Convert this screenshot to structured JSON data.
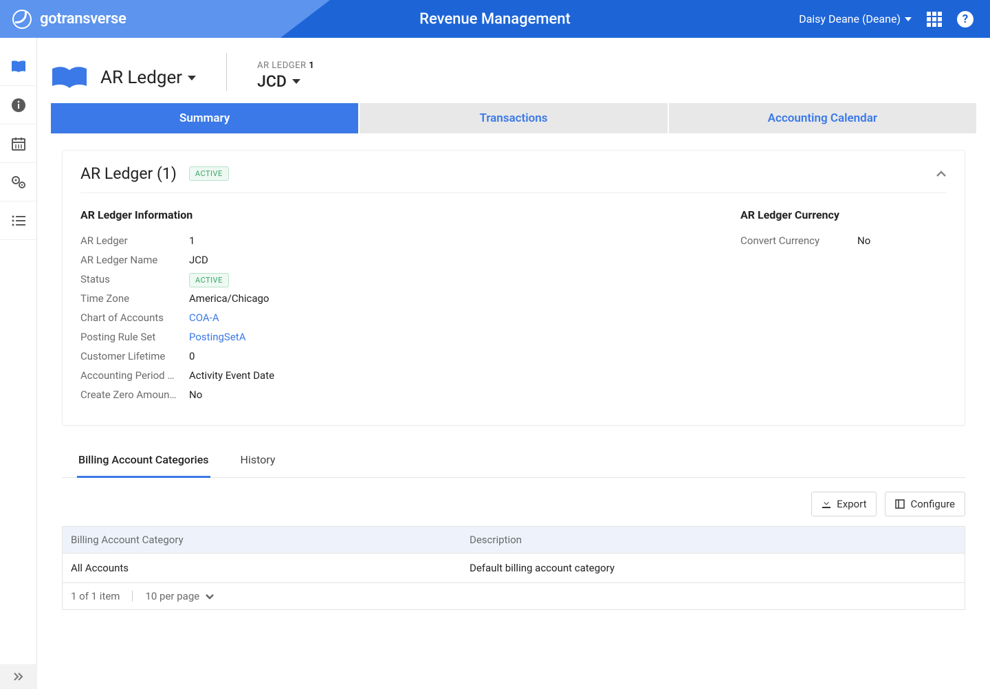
{
  "header": {
    "brand": "gotransverse",
    "title": "Revenue Management",
    "user": "Daisy Deane (Deane)"
  },
  "breadcrumb": {
    "ledger_label": "AR Ledger",
    "sub_label": "AR LEDGER",
    "sub_label_num": "1",
    "sub_value": "JCD"
  },
  "tabs": {
    "summary": "Summary",
    "transactions": "Transactions",
    "calendar": "Accounting Calendar"
  },
  "card": {
    "title": "AR Ledger (1)",
    "badge": "ACTIVE",
    "info_section_title": "AR Ledger Information",
    "currency_section_title": "AR Ledger Currency",
    "rows": {
      "ar_ledger_label": "AR Ledger",
      "ar_ledger_val": "1",
      "name_label": "AR Ledger Name",
      "name_val": "JCD",
      "status_label": "Status",
      "status_val": "ACTIVE",
      "tz_label": "Time Zone",
      "tz_val": "America/Chicago",
      "coa_label": "Chart of Accounts",
      "coa_val": "COA-A",
      "prs_label": "Posting Rule Set",
      "prs_val": "PostingSetA",
      "cl_label": "Customer Lifetime",
      "cl_val": "0",
      "ap_label": "Accounting Period …",
      "ap_val": "Activity Event Date",
      "cz_label": "Create Zero Amoun…",
      "cz_val": "No",
      "cc_label": "Convert Currency",
      "cc_val": "No"
    }
  },
  "subtabs": {
    "bac": "Billing Account Categories",
    "history": "History"
  },
  "toolbar": {
    "export": "Export",
    "configure": "Configure"
  },
  "table": {
    "col_a": "Billing Account Category",
    "col_b": "Description",
    "rows": [
      {
        "a": "All Accounts",
        "b": "Default billing account category"
      }
    ],
    "footer_count": "1 of 1 item",
    "footer_page": "10 per page"
  }
}
